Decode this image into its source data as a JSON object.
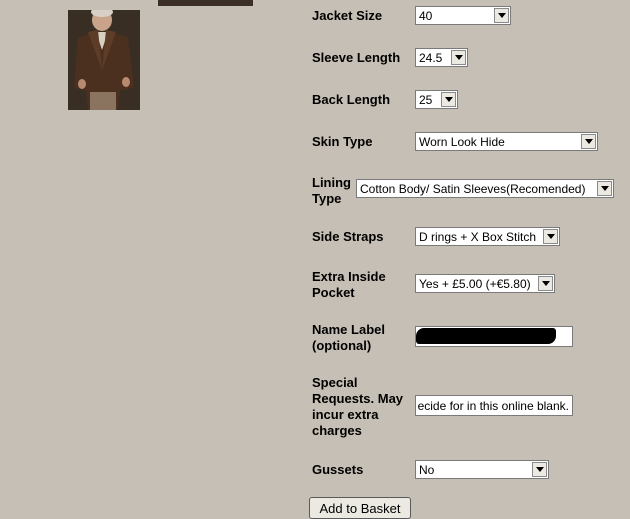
{
  "images": {
    "jacket_photo": "man-in-brown-leather-jacket",
    "top_photo": "jacket-photo-cropped"
  },
  "fields": {
    "jacket_size": {
      "label": "Jacket Size",
      "value": "40"
    },
    "sleeve_length": {
      "label": "Sleeve Length",
      "value": "24.5"
    },
    "back_length": {
      "label": "Back Length",
      "value": "25"
    },
    "skin_type": {
      "label": "Skin Type",
      "value": "Worn Look Hide"
    },
    "lining_type": {
      "label_line1": "Lining",
      "label_line2": "Type",
      "value": "Cotton Body/ Satin Sleeves(Recomended)"
    },
    "side_straps": {
      "label": "Side Straps",
      "value": "D rings + X Box Stitch"
    },
    "extra_inside_pocket": {
      "label_line1": "Extra Inside",
      "label_line2": "Pocket",
      "value": "Yes + £5.00 (+€5.80)"
    },
    "name_label": {
      "label_line1": "Name Label",
      "label_line2": "(optional)",
      "value": ""
    },
    "special_requests": {
      "label_line1": "Special",
      "label_line2": "Requests. May",
      "label_line3": "incur extra",
      "label_line4": "charges",
      "value": "ecide for in this online blank."
    },
    "gussets": {
      "label": "Gussets",
      "value": "No"
    }
  },
  "actions": {
    "add_to_basket": "Add to Basket"
  },
  "colors": {
    "page_background": "#c6bfb5",
    "redaction": "#000000"
  }
}
